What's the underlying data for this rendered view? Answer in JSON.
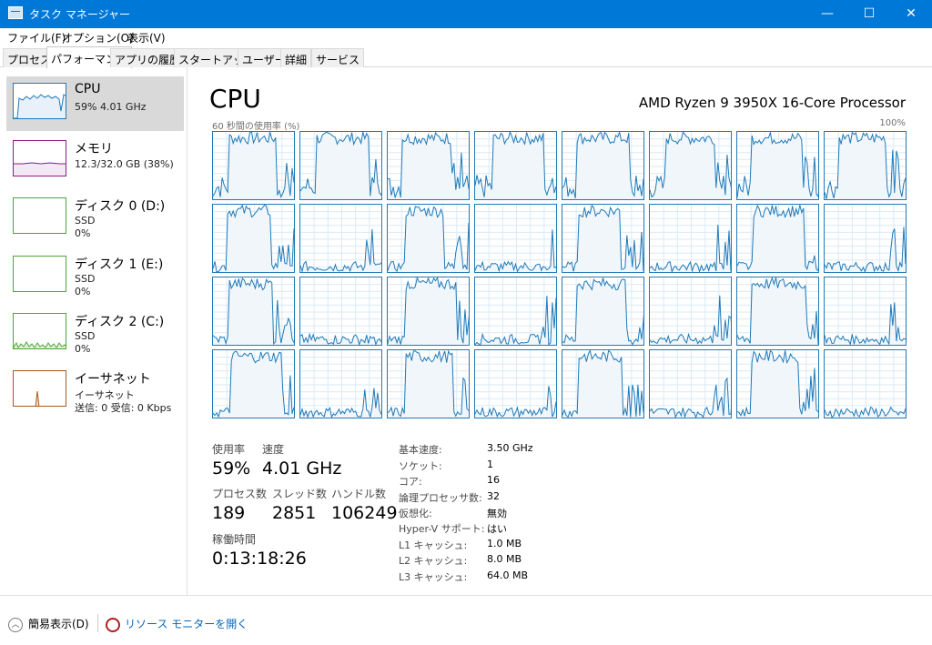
{
  "window": {
    "title": "タスク マネージャー",
    "minimize": "—",
    "maximize": "☐",
    "close": "✕"
  },
  "menu": [
    "ファイル(F)",
    "オプション(O)",
    "表示(V)"
  ],
  "tabs": [
    "プロセス",
    "パフォーマンス",
    "アプリの履歴",
    "スタートアップ",
    "ユーザー",
    "詳細",
    "サービス"
  ],
  "active_tab": "パフォーマンス",
  "sidebar": [
    {
      "title": "CPU",
      "sub1": "59%  4.01 GHz",
      "sub2": "",
      "color": "#1f7ab8",
      "icon": "cpu-thumbnail-graph"
    },
    {
      "title": "メモリ",
      "sub1": "12.3/32.0 GB (38%)",
      "sub2": "",
      "color": "#8b1a8b",
      "icon": "memory-thumbnail-graph"
    },
    {
      "title": "ディスク 0 (D:)",
      "sub1": "SSD",
      "sub2": "0%",
      "color": "#4da833",
      "icon": "disk-thumbnail-graph"
    },
    {
      "title": "ディスク 1 (E:)",
      "sub1": "SSD",
      "sub2": "0%",
      "color": "#4da833",
      "icon": "disk-thumbnail-graph"
    },
    {
      "title": "ディスク 2 (C:)",
      "sub1": "SSD",
      "sub2": "0%",
      "color": "#4da833",
      "icon": "disk-thumbnail-graph"
    },
    {
      "title": "イーサネット",
      "sub1": "イーサネット",
      "sub2": "送信: 0  受信: 0 Kbps",
      "color": "#a8581b",
      "icon": "network-thumbnail-graph"
    }
  ],
  "main": {
    "title": "CPU",
    "processor": "AMD Ryzen 9 3950X 16-Core Processor",
    "graph_caption": "60 秒間の使用率 (%)",
    "graph_max": "100%",
    "logical_processor_count": 32,
    "stats": {
      "usage_label": "使用率",
      "usage": "59%",
      "speed_label": "速度",
      "speed": "4.01 GHz",
      "processes_label": "プロセス数",
      "processes": "189",
      "threads_label": "スレッド数",
      "threads": "2851",
      "handles_label": "ハンドル数",
      "handles": "106249",
      "uptime_label": "稼働時間",
      "uptime": "0:13:18:26"
    },
    "specs": [
      {
        "k": "基本速度:",
        "v": "3.50 GHz"
      },
      {
        "k": "ソケット:",
        "v": "1"
      },
      {
        "k": "コア:",
        "v": "16"
      },
      {
        "k": "論理プロセッサ数:",
        "v": "32"
      },
      {
        "k": "仮想化:",
        "v": "無効"
      },
      {
        "k": "Hyper-V サポート:",
        "v": "はい"
      },
      {
        "k": "L1 キャッシュ:",
        "v": "1.0 MB"
      },
      {
        "k": "L2 キャッシュ:",
        "v": "8.0 MB"
      },
      {
        "k": "L3 キャッシュ:",
        "v": "64.0 MB"
      }
    ]
  },
  "footer": {
    "fewer_details": "簡易表示(D)",
    "resource_monitor": "リソース モニターを開く"
  },
  "colors": {
    "accent": "#0078d7",
    "cpu_line": "#1f7ab8",
    "cpu_fill": "#f1f6fb",
    "grid": "#d9eaf7"
  }
}
